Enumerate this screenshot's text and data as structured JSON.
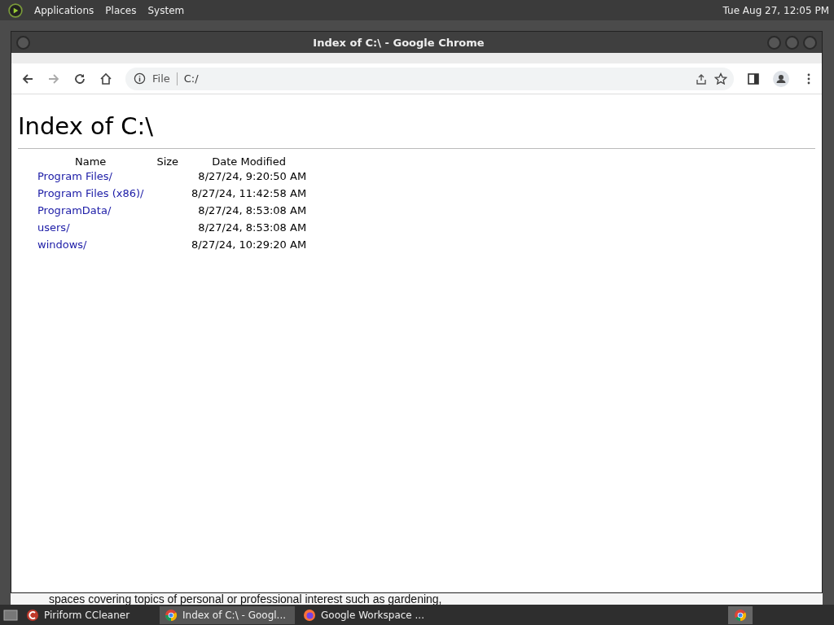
{
  "top_panel": {
    "menus": [
      "Applications",
      "Places",
      "System"
    ],
    "clock": "Tue Aug 27, 12:05 PM"
  },
  "window": {
    "title": "Index of C:\\ - Google Chrome"
  },
  "toolbar": {
    "scheme": "File",
    "address": "C:/"
  },
  "page": {
    "heading": "Index of C:\\",
    "columns": [
      "Name",
      "Size",
      "Date Modified"
    ],
    "rows": [
      {
        "name": "Program Files/",
        "size": "",
        "date": "8/27/24, 9:20:50 AM"
      },
      {
        "name": "Program Files (x86)/",
        "size": "",
        "date": "8/27/24, 11:42:58 AM"
      },
      {
        "name": "ProgramData/",
        "size": "",
        "date": "8/27/24, 8:53:08 AM"
      },
      {
        "name": "users/",
        "size": "",
        "date": "8/27/24, 8:53:08 AM"
      },
      {
        "name": "windows/",
        "size": "",
        "date": "8/27/24, 10:29:20 AM"
      }
    ]
  },
  "background_text": "spaces covering topics of personal or professional interest such as gardening,",
  "taskbar": {
    "items": [
      {
        "label": "Piriform CCleaner",
        "kind": "ccleaner",
        "selected": false
      },
      {
        "label": "Index of C:\\ - Googl...",
        "kind": "chrome",
        "selected": true
      },
      {
        "label": "Google Workspace ...",
        "kind": "firefox",
        "selected": false
      }
    ]
  }
}
